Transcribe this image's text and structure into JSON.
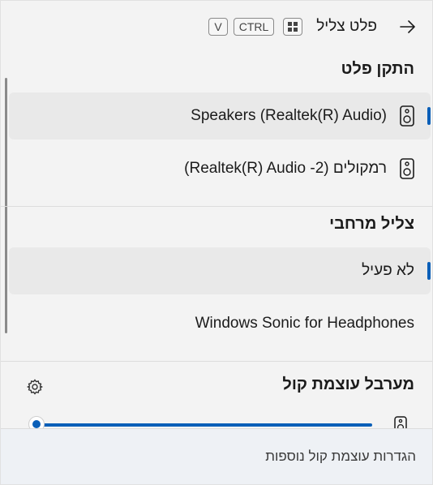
{
  "header": {
    "title": "פלט צליל",
    "shortcut_keys": [
      "V",
      "CTRL"
    ]
  },
  "output_section": {
    "title": "התקן פלט",
    "devices": [
      {
        "label": "Speakers (Realtek(R) Audio)",
        "icon": "speaker-icon",
        "selected": true
      },
      {
        "label": "רמקולים (2- Realtek(R) Audio)",
        "icon": "speaker-icon",
        "selected": false
      }
    ]
  },
  "spatial_section": {
    "title": "צליל מרחבי",
    "options": [
      {
        "label": "לא פעיל",
        "selected": true
      },
      {
        "label": "Windows Sonic for Headphones",
        "selected": false
      }
    ]
  },
  "volume_section": {
    "title": "מערבל עוצמת קול",
    "settings_icon": "gear-icon",
    "level": 1.0
  },
  "footer": {
    "more_settings": "הגדרות עוצמת קול נוספות"
  },
  "colors": {
    "accent": "#0a5fb8",
    "selected_bg": "#e9e9e9",
    "panel_bg": "#f3f3f3"
  }
}
